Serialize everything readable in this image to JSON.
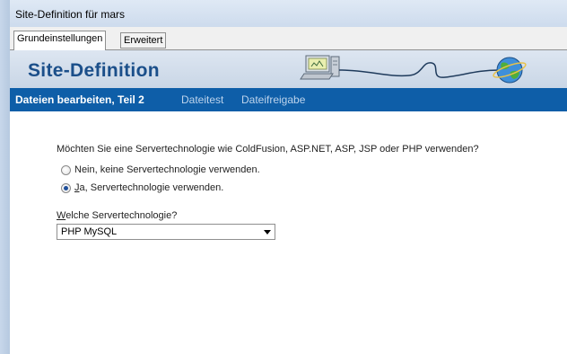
{
  "window": {
    "title": "Site-Definition für mars"
  },
  "tabs": [
    {
      "label": "Grundeinstellungen",
      "active": true
    },
    {
      "label": "Erweitert",
      "active": false
    }
  ],
  "banner": {
    "title": "Site-Definition"
  },
  "nav": {
    "items": [
      {
        "label": "Dateien bearbeiten, Teil 2",
        "active": true
      },
      {
        "label": "Dateitest",
        "active": false
      },
      {
        "label": "Dateifreigabe",
        "active": false
      }
    ]
  },
  "form": {
    "question": "Möchten Sie eine Servertechnologie wie ColdFusion, ASP.NET, ASP, JSP oder PHP verwenden?",
    "options": [
      {
        "label": "Nein, keine Servertechnologie verwenden.",
        "checked": false
      },
      {
        "mnemonic": "J",
        "label_rest": "a, Servertechnologie verwenden.",
        "checked": true
      }
    ],
    "tech_label_mnemonic": "W",
    "tech_label_rest": "elche Servertechnologie?",
    "tech_selected": "PHP MySQL"
  },
  "colors": {
    "nav_bg": "#0e5ea8",
    "banner_title": "#1b4f8a"
  }
}
